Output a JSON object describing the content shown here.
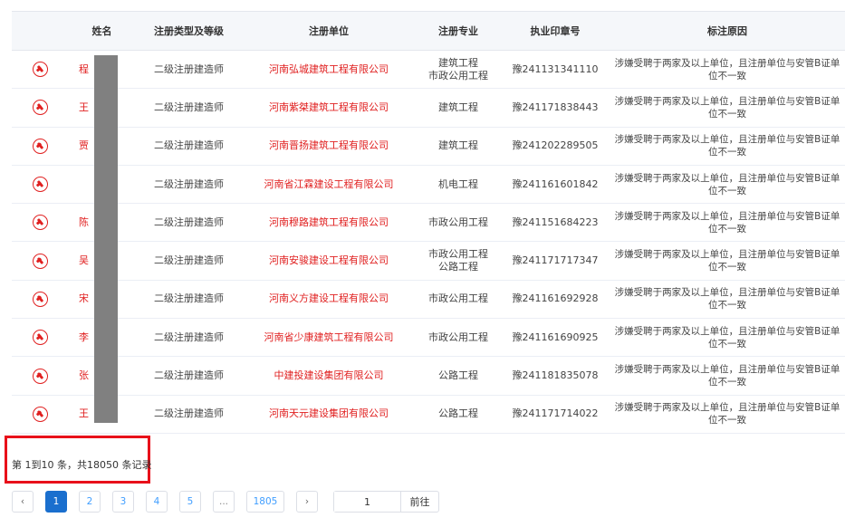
{
  "table": {
    "headers": [
      "",
      "姓名",
      "注册类型及等级",
      "注册单位",
      "注册专业",
      "执业印章号",
      "标注原因"
    ],
    "rows": [
      {
        "name": "程",
        "type": "二级注册建造师",
        "unit": "河南弘城建筑工程有限公司",
        "specialty_1": "建筑工程",
        "specialty_2": "市政公用工程",
        "seal": "豫241131341110",
        "reason": "涉嫌受聘于两家及以上单位，且注册单位与安管B证单位不一致"
      },
      {
        "name": "王",
        "type": "二级注册建造师",
        "unit": "河南紫桀建筑工程有限公司",
        "specialty_1": "建筑工程",
        "specialty_2": "",
        "seal": "豫241171838443",
        "reason": "涉嫌受聘于两家及以上单位，且注册单位与安管B证单位不一致"
      },
      {
        "name": "贾",
        "type": "二级注册建造师",
        "unit": "河南晋扬建筑工程有限公司",
        "specialty_1": "建筑工程",
        "specialty_2": "",
        "seal": "豫241202289505",
        "reason": "涉嫌受聘于两家及以上单位，且注册单位与安管B证单位不一致"
      },
      {
        "name": "",
        "type": "二级注册建造师",
        "unit": "河南省江霖建设工程有限公司",
        "specialty_1": "机电工程",
        "specialty_2": "",
        "seal": "豫241161601842",
        "reason": "涉嫌受聘于两家及以上单位，且注册单位与安管B证单位不一致"
      },
      {
        "name": "陈",
        "type": "二级注册建造师",
        "unit": "河南穆路建筑工程有限公司",
        "specialty_1": "市政公用工程",
        "specialty_2": "",
        "seal": "豫241151684223",
        "reason": "涉嫌受聘于两家及以上单位，且注册单位与安管B证单位不一致"
      },
      {
        "name": "吴",
        "type": "二级注册建造师",
        "unit": "河南安骏建设工程有限公司",
        "specialty_1": "市政公用工程",
        "specialty_2": "公路工程",
        "seal": "豫241171717347",
        "reason": "涉嫌受聘于两家及以上单位，且注册单位与安管B证单位不一致"
      },
      {
        "name": "宋",
        "type": "二级注册建造师",
        "unit": "河南义方建设工程有限公司",
        "specialty_1": "市政公用工程",
        "specialty_2": "",
        "seal": "豫241161692928",
        "reason": "涉嫌受聘于两家及以上单位，且注册单位与安管B证单位不一致"
      },
      {
        "name": "李",
        "type": "二级注册建造师",
        "unit": "河南省少康建筑工程有限公司",
        "specialty_1": "市政公用工程",
        "specialty_2": "",
        "seal": "豫241161690925",
        "reason": "涉嫌受聘于两家及以上单位，且注册单位与安管B证单位不一致"
      },
      {
        "name": "张",
        "type": "二级注册建造师",
        "unit": "中建投建设集团有限公司",
        "specialty_1": "公路工程",
        "specialty_2": "",
        "seal": "豫241181835078",
        "reason": "涉嫌受聘于两家及以上单位，且注册单位与安管B证单位不一致"
      },
      {
        "name": "王",
        "type": "二级注册建造师",
        "unit": "河南天元建设集团有限公司",
        "specialty_1": "公路工程",
        "specialty_2": "",
        "seal": "豫241171714022",
        "reason": "涉嫌受聘于两家及以上单位，且注册单位与安管B证单位不一致"
      }
    ]
  },
  "summary": "第 1到10 条，共18050 条记录",
  "pagination": {
    "prev": "‹",
    "pages": [
      "1",
      "2",
      "3",
      "4",
      "5",
      "...",
      "1805"
    ],
    "active_page": "1",
    "next": "›",
    "jump_value": "1",
    "jump_label": "前往"
  },
  "colors": {
    "accent": "#e02020",
    "highlight_box": "#e8101a",
    "active_page": "#1a6fce"
  },
  "icons": {
    "row_mark": "marker-icon"
  }
}
